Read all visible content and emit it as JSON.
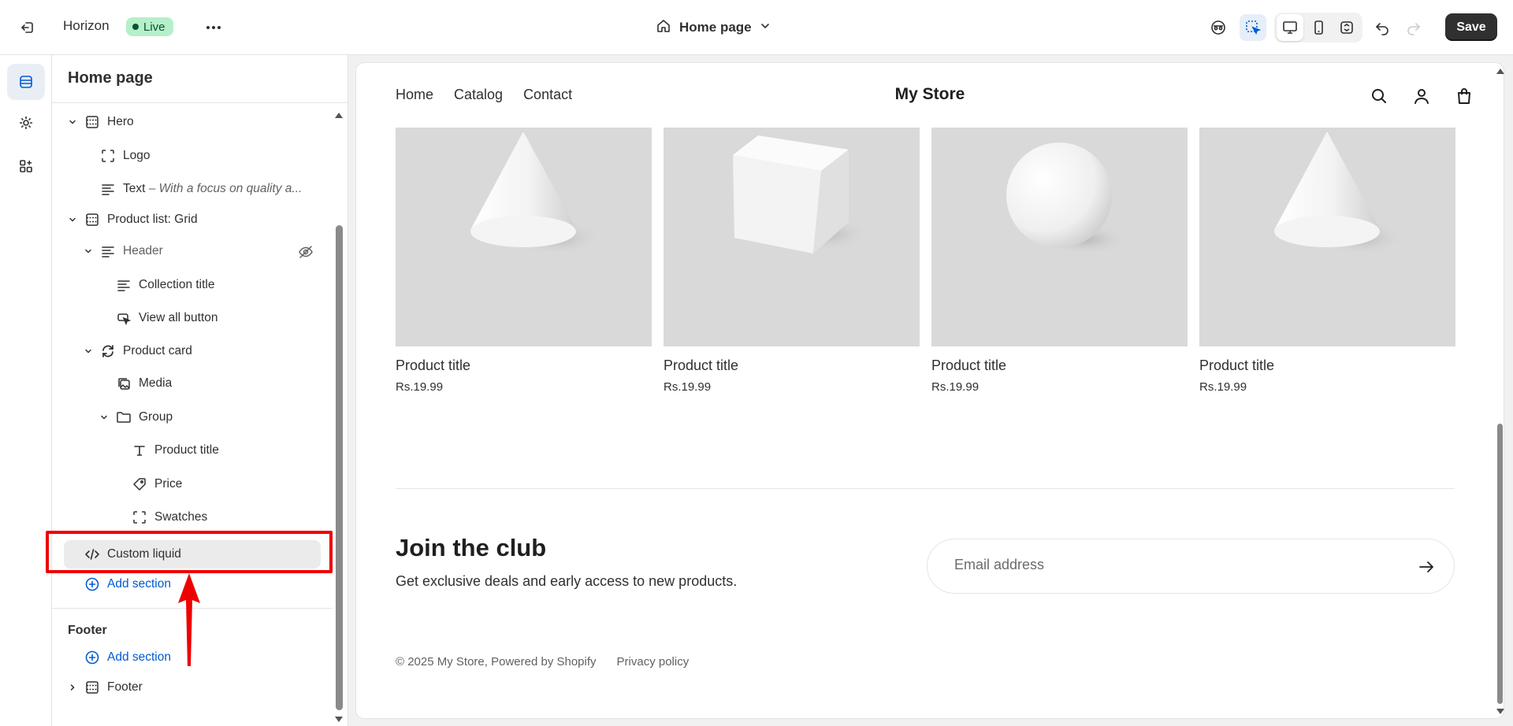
{
  "topbar": {
    "theme_name": "Horizon",
    "live_label": "Live",
    "page_picker_label": "Home page",
    "save_label": "Save"
  },
  "sidebar": {
    "title": "Home page",
    "tree": {
      "hero": "Hero",
      "logo": "Logo",
      "text": "Text",
      "text_sub": "– With a focus on quality a...",
      "product_list": "Product list: Grid",
      "header": "Header",
      "collection_title": "Collection title",
      "view_all_button": "View all button",
      "product_card": "Product card",
      "media": "Media",
      "group": "Group",
      "product_title": "Product title",
      "price": "Price",
      "swatches": "Swatches",
      "custom_liquid": "Custom liquid",
      "add_section": "Add section"
    },
    "footer": {
      "heading": "Footer",
      "add_section": "Add section",
      "footer_item": "Footer"
    }
  },
  "preview": {
    "nav": [
      "Home",
      "Catalog",
      "Contact"
    ],
    "store_name": "My Store",
    "products": [
      {
        "title": "Product title",
        "price": "Rs.19.99",
        "shape": "cone"
      },
      {
        "title": "Product title",
        "price": "Rs.19.99",
        "shape": "cube"
      },
      {
        "title": "Product title",
        "price": "Rs.19.99",
        "shape": "sphere"
      },
      {
        "title": "Product title",
        "price": "Rs.19.99",
        "shape": "cone"
      }
    ],
    "join_heading": "Join the club",
    "join_sub": "Get exclusive deals and early access to new products.",
    "email_placeholder": "Email address",
    "footer_copyright": "© 2025 My Store, Powered by Shopify",
    "footer_privacy": "Privacy policy"
  },
  "colors": {
    "accent_blue": "#005bd3",
    "live_badge_bg": "#b5f0c9",
    "annotation_red": "#ee0000",
    "save_button_bg": "#303030"
  }
}
